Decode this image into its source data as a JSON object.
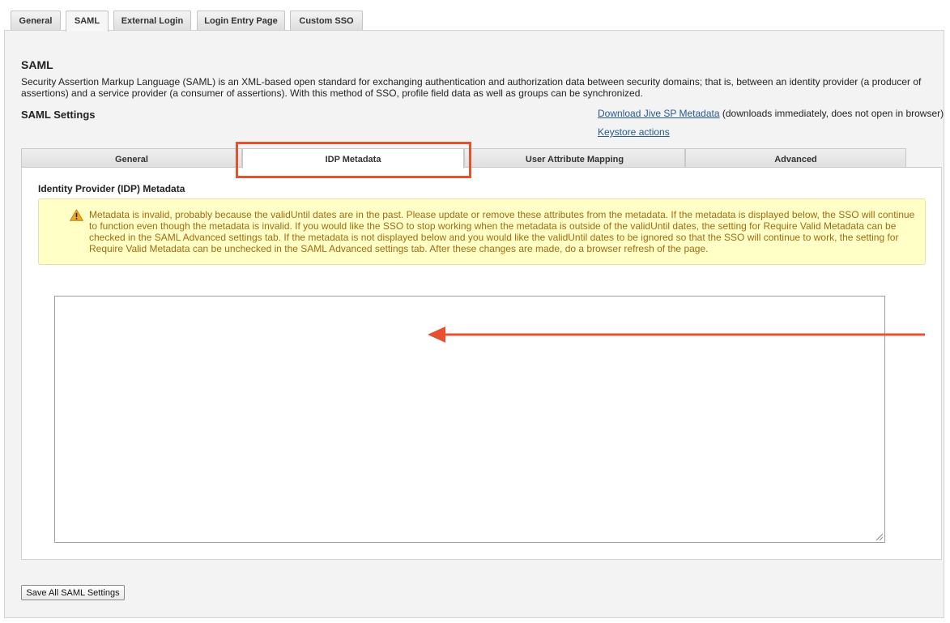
{
  "top_tabs": [
    {
      "label": "General",
      "active": false
    },
    {
      "label": "SAML",
      "active": true
    },
    {
      "label": "External Login",
      "active": false
    },
    {
      "label": "Login Entry Page",
      "active": false
    },
    {
      "label": "Custom SSO",
      "active": false
    }
  ],
  "saml": {
    "title": "SAML",
    "description": "Security Assertion Markup Language (SAML) is an XML-based open standard for exchanging authentication and authorization data between security domains; that is, between an identity provider (a producer of assertions) and a service provider (a consumer of assertions). With this method of SSO, profile field data as well as groups can be synchronized."
  },
  "settings": {
    "title": "SAML Settings",
    "download_link": "Download Jive SP Metadata",
    "download_note": " (downloads immediately, does not open in browser)",
    "keystore_link": "Keystore actions"
  },
  "inner_tabs": [
    {
      "label": "General",
      "active": false
    },
    {
      "label": "IDP Metadata",
      "active": true
    },
    {
      "label": "User Attribute Mapping",
      "active": false
    },
    {
      "label": "Advanced",
      "active": false
    }
  ],
  "idp": {
    "title": "Identity Provider (IDP) Metadata",
    "warning": "Metadata is invalid, probably because the validUntil dates are in the past. Please update or remove these attributes from the metadata. If the metadata is displayed below, the SSO will continue to function even though the metadata is invalid. If you would like the SSO to stop working when the metadata is outside of the validUntil dates, the setting for Require Valid Metadata can be checked in the SAML Advanced settings tab. If the metadata is not displayed below and you would like the validUntil dates to be ignored so that the SSO will continue to work, the setting for Require Valid Metadata can be unchecked in the SAML Advanced settings tab. After these changes are made, do a browser refresh of the page.",
    "metadata_value": ""
  },
  "save_label": "Save All SAML Settings",
  "icons": {
    "warning": "warning-triangle-icon",
    "annotation": "red-arrow-annotation"
  },
  "colors": {
    "annotation": "#e8502f",
    "warning_bg": "#ffffc6",
    "warning_text": "#a36a12",
    "link": "#2a5a8c"
  }
}
